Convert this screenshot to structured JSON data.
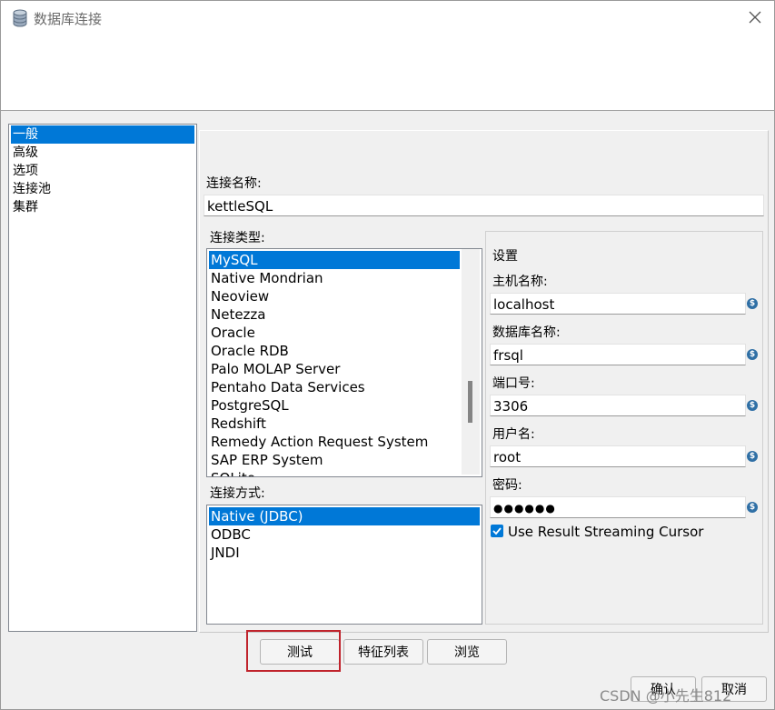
{
  "window": {
    "title": "数据库连接",
    "title_icon": "database-icon",
    "close_icon": "close-icon"
  },
  "nav": {
    "items": [
      {
        "label": "一般",
        "selected": true
      },
      {
        "label": "高级",
        "selected": false
      },
      {
        "label": "选项",
        "selected": false
      },
      {
        "label": "连接池",
        "selected": false
      },
      {
        "label": "集群",
        "selected": false
      }
    ]
  },
  "general": {
    "connection_name_label": "连接名称:",
    "connection_name_value": "kettleSQL",
    "connection_type_label": "连接类型:",
    "connection_types": [
      "MySQL",
      "Native Mondrian",
      "Neoview",
      "Netezza",
      "Oracle",
      "Oracle RDB",
      "Palo MOLAP Server",
      "Pentaho Data Services",
      "PostgreSQL",
      "Redshift",
      "Remedy Action Request System",
      "SAP ERP System",
      "SQLite"
    ],
    "connection_type_selected": "MySQL",
    "access_label": "连接方式:",
    "access_methods": [
      "Native (JDBC)",
      "ODBC",
      "JNDI"
    ],
    "access_selected": "Native (JDBC)"
  },
  "settings": {
    "title": "设置",
    "host_label": "主机名称:",
    "host_value": "localhost",
    "db_label": "数据库名称:",
    "db_value": "frsql",
    "port_label": "端口号:",
    "port_value": "3306",
    "user_label": "用户名:",
    "user_value": "root",
    "password_label": "密码:",
    "password_value": "●●●●●●",
    "variable_icon": "variable-icon",
    "streaming_label": "Use Result Streaming Cursor",
    "streaming_checked": true
  },
  "buttons": {
    "test": "测试",
    "features": "特征列表",
    "explore": "浏览",
    "ok": "确认",
    "cancel": "取消"
  },
  "watermark": "CSDN @小先生812",
  "colors": {
    "selection": "#0078d7",
    "highlight_border": "#c0232c",
    "variable_icon": "#2f6fa5"
  }
}
